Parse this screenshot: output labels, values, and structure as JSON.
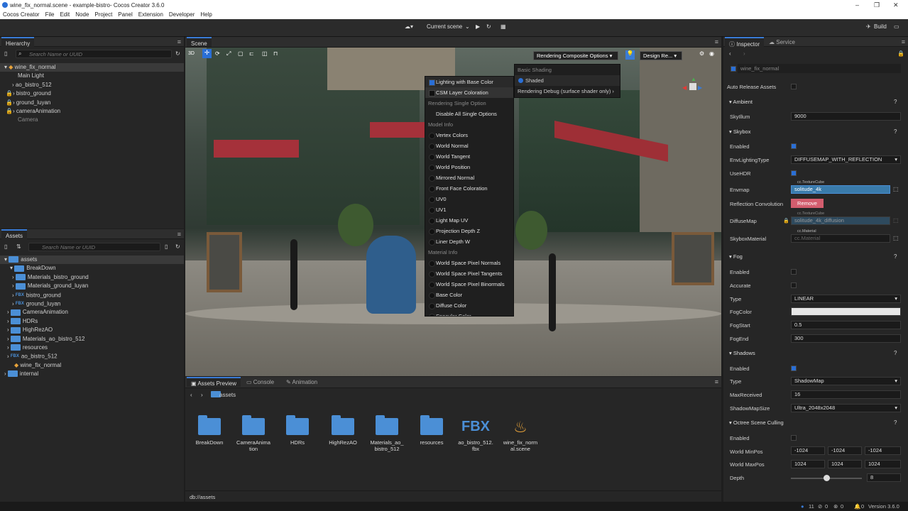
{
  "window": {
    "title": "wine_fix_normal.scene - example-bistro- Cocos Creator 3.6.0"
  },
  "menu": [
    "Cocos Creator",
    "File",
    "Edit",
    "Node",
    "Project",
    "Panel",
    "Extension",
    "Developer",
    "Help"
  ],
  "toolbar": {
    "scene_select": "Current scene",
    "build": "Build"
  },
  "hierarchy": {
    "tab": "Hierarchy",
    "search_placeholder": "Search Name or UUID",
    "nodes": [
      "wine_fix_normal",
      "Main Light",
      "ao_bistro_512",
      "bistro_ground",
      "ground_luyan",
      "cameraAnimation",
      "Camera"
    ]
  },
  "assets": {
    "tab": "Assets",
    "search_placeholder": "Search Name or UUID",
    "items": [
      "assets",
      "BreakDown",
      "Materials_bistro_ground",
      "Materials_ground_luyan",
      "bistro_ground",
      "ground_luyan",
      "CameraAnimation",
      "HDRs",
      "HighRezAO",
      "Materials_ao_bistro_512",
      "resources",
      "ao_bistro_512",
      "wine_fix_normal",
      "internal"
    ]
  },
  "scene": {
    "tab": "Scene",
    "mode3d": "3D",
    "render_opt": "Rendering Composite Options",
    "design": "Design Re...",
    "menu": [
      {
        "t": "Lighting with Base Color",
        "k": "ckon"
      },
      {
        "t": "CSM Layer Coloration",
        "k": "ck"
      },
      {
        "t": "Rendering Single Option",
        "k": "sec"
      },
      {
        "t": "Disable All Single Options",
        "k": "on"
      },
      {
        "t": "Model Info",
        "k": "sec"
      },
      {
        "t": "Vertex Colors",
        "k": "r"
      },
      {
        "t": "World Normal",
        "k": "r"
      },
      {
        "t": "World Tangent",
        "k": "r"
      },
      {
        "t": "World Position",
        "k": "r"
      },
      {
        "t": "Mirrored Normal",
        "k": "r"
      },
      {
        "t": "Front Face Coloration",
        "k": "r"
      },
      {
        "t": "UV0",
        "k": "r"
      },
      {
        "t": "UV1",
        "k": "r"
      },
      {
        "t": "Light Map UV",
        "k": "r"
      },
      {
        "t": "Projection Depth Z",
        "k": "r"
      },
      {
        "t": "Liner Depth W",
        "k": "r"
      },
      {
        "t": "Material Info",
        "k": "sec"
      },
      {
        "t": "World Space Pixel Normals",
        "k": "r"
      },
      {
        "t": "World Space Pixel Tangents",
        "k": "r"
      },
      {
        "t": "World Space Pixel Binormals",
        "k": "r"
      },
      {
        "t": "Base Color",
        "k": "r"
      },
      {
        "t": "Diffuse Color",
        "k": "r"
      },
      {
        "t": "Specular Color",
        "k": "r"
      }
    ],
    "submenu": {
      "head": "Basic Shading",
      "item": "Shaded",
      "debug": "Rendering Debug (surface shader only)"
    }
  },
  "bottom": {
    "tabs": [
      "Assets Preview",
      "Console",
      "Animation"
    ],
    "path": "assets",
    "status": "db://assets",
    "files": [
      {
        "n": "BreakDown",
        "t": "folder"
      },
      {
        "n": "CameraAnima tion",
        "t": "folder"
      },
      {
        "n": "HDRs",
        "t": "folder"
      },
      {
        "n": "HighRezAO",
        "t": "folder"
      },
      {
        "n": "Materials_ao_ bistro_512",
        "t": "folder"
      },
      {
        "n": "resources",
        "t": "folder"
      },
      {
        "n": "ao_bistro_512. fbx",
        "t": "fbx"
      },
      {
        "n": "wine_fix_norm al.scene",
        "t": "scene"
      }
    ]
  },
  "inspector": {
    "tab": "Inspector",
    "tab2": "Service",
    "node": "wine_fix_normal",
    "auto_release": "Auto Release Assets",
    "ambient": "Ambient",
    "skyillum_label": "SkyIllum",
    "skyillum": "9000",
    "skybox": "Skybox",
    "enabled": "Enabled",
    "envlt_label": "EnvLightingType",
    "envlt": "DIFFUSEMAP_WITH_REFLECTION",
    "usehdr": "UseHDR",
    "envmap_label": "Envmap",
    "envmap_type": "cc.TextureCube",
    "envmap": "solitude_4k",
    "refl_label": "Reflection Convolution",
    "remove": "Remove",
    "diffuse_label": "DiffuseMap",
    "diffuse_type": "cc.TextureCube",
    "diffuse": "solitude_4k_diffusion",
    "skymat_label": "SkyboxMaterial",
    "skymat_type": "cc.Material",
    "skymat": "cc.Material",
    "fog": "Fog",
    "accurate": "Accurate",
    "type_label": "Type",
    "fog_type": "LINEAR",
    "fogcolor": "FogColor",
    "fogstart_label": "FogStart",
    "fogstart": "0.5",
    "fogend_label": "FogEnd",
    "fogend": "300",
    "shadows": "Shadows",
    "shadow_type": "ShadowMap",
    "maxrec_label": "MaxReceived",
    "maxrec": "16",
    "smsize_label": "ShadowMapSize",
    "smsize": "Ultra_2048x2048",
    "octree": "Octree Scene Culling",
    "minpos_label": "World MinPos",
    "minpos": [
      "-1024",
      "-1024",
      "-1024"
    ],
    "maxpos_label": "World MaxPos",
    "maxpos": [
      "1024",
      "1024",
      "1024"
    ],
    "depth_label": "Depth",
    "depth": "8"
  },
  "status": {
    "c1": "11",
    "c2": "0",
    "c3": "0",
    "c4": "0",
    "version": "Version 3.6.0"
  }
}
